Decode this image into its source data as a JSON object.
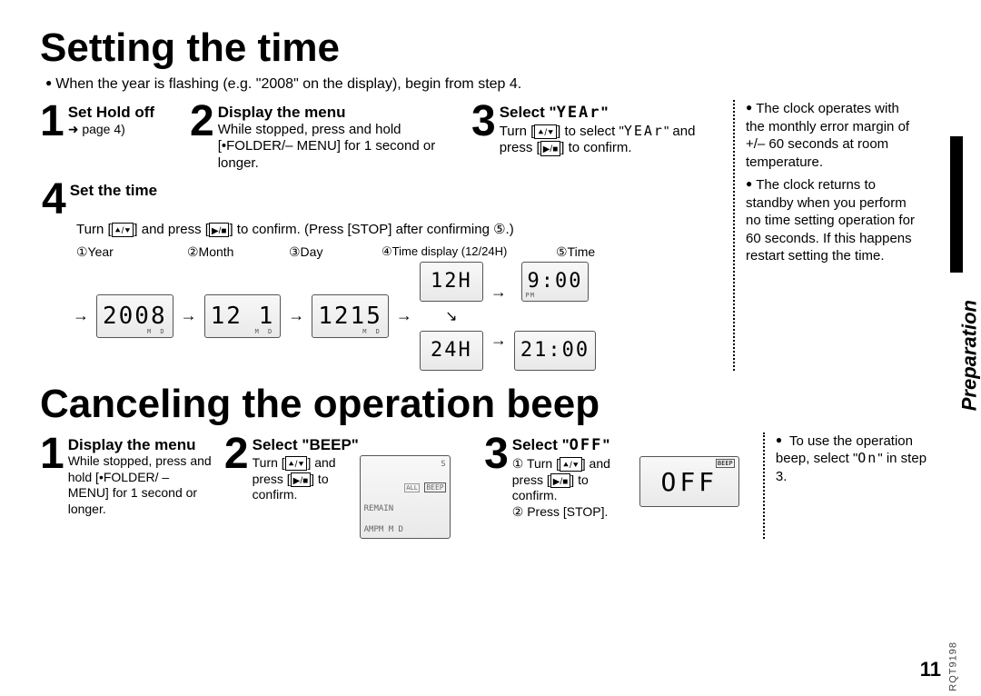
{
  "section_label": "Preparation",
  "title1": "Setting the time",
  "intro": "When the year is flashing (e.g. \"2008\" on the display), begin from step 4.",
  "steps_time": {
    "s1": {
      "num": "1",
      "title": "Set Hold off",
      "ref": "➜ page 4)"
    },
    "s2": {
      "num": "2",
      "title": "Display the menu",
      "text": "While stopped, press and hold [•FOLDER/– MENU] for 1 second or longer."
    },
    "s3": {
      "num": "3",
      "title_a": "Select \"",
      "title_b": "\"",
      "lcd_word": "YEAr",
      "text_a": "Turn [",
      "text_b": "] to select \"",
      "text_c": "\" and press [",
      "text_d": "] to confirm."
    },
    "s4": {
      "num": "4",
      "title": "Set the time",
      "text_a": "Turn [",
      "text_b": "] and press [",
      "text_c": "] to confirm. (Press [STOP] after confirming ⑤.)",
      "labels": {
        "c1": "①Year",
        "c2": "②Month",
        "c3": "③Day",
        "c4": "④Time display (12/24H)",
        "c5": "⑤Time"
      },
      "lcd": {
        "year": "2008",
        "month": "12 1",
        "day": "1215",
        "h12": "12H",
        "h24": "24H",
        "t12": "9:00",
        "t24": "21:00",
        "md": "M  D",
        "pm": "PM"
      }
    }
  },
  "side_time": {
    "p1": "The clock operates with the monthly error margin of +/– 60 seconds at room temperature.",
    "p2": "The clock returns to standby when you perform no time setting operation for 60 seconds. If this happens restart setting the time."
  },
  "title2": "Canceling the operation beep",
  "steps_beep": {
    "s1": {
      "num": "1",
      "title": "Display the menu",
      "text": "While stopped, press and hold [•FOLDER/ – MENU] for 1 second or longer."
    },
    "s2": {
      "num": "2",
      "title": "Select \"BEEP\"",
      "text_a": "Turn [",
      "text_b": "] and press [",
      "text_c": "] to confirm.",
      "lcd": {
        "top_s": "S",
        "remain": "REMAIN",
        "beep": "BEEP",
        "all": "ALL",
        "ampm": "AMPM  M  D"
      }
    },
    "s3": {
      "num": "3",
      "title_a": "Select \"",
      "title_b": "\"",
      "off_word": "OFF",
      "line1_a": "① Turn [",
      "line1_b": "] and press [",
      "line1_c": "] to confirm.",
      "line2": "② Press [STOP].",
      "lcd": {
        "off": "OFF",
        "beep_lbl": "BEEP"
      }
    }
  },
  "side_beep": {
    "p1_a": "To use the operation beep, select \"",
    "p1_b": "\" in step 3.",
    "on_word": "On"
  },
  "page_number": "11",
  "doc_code": "RQT9198"
}
